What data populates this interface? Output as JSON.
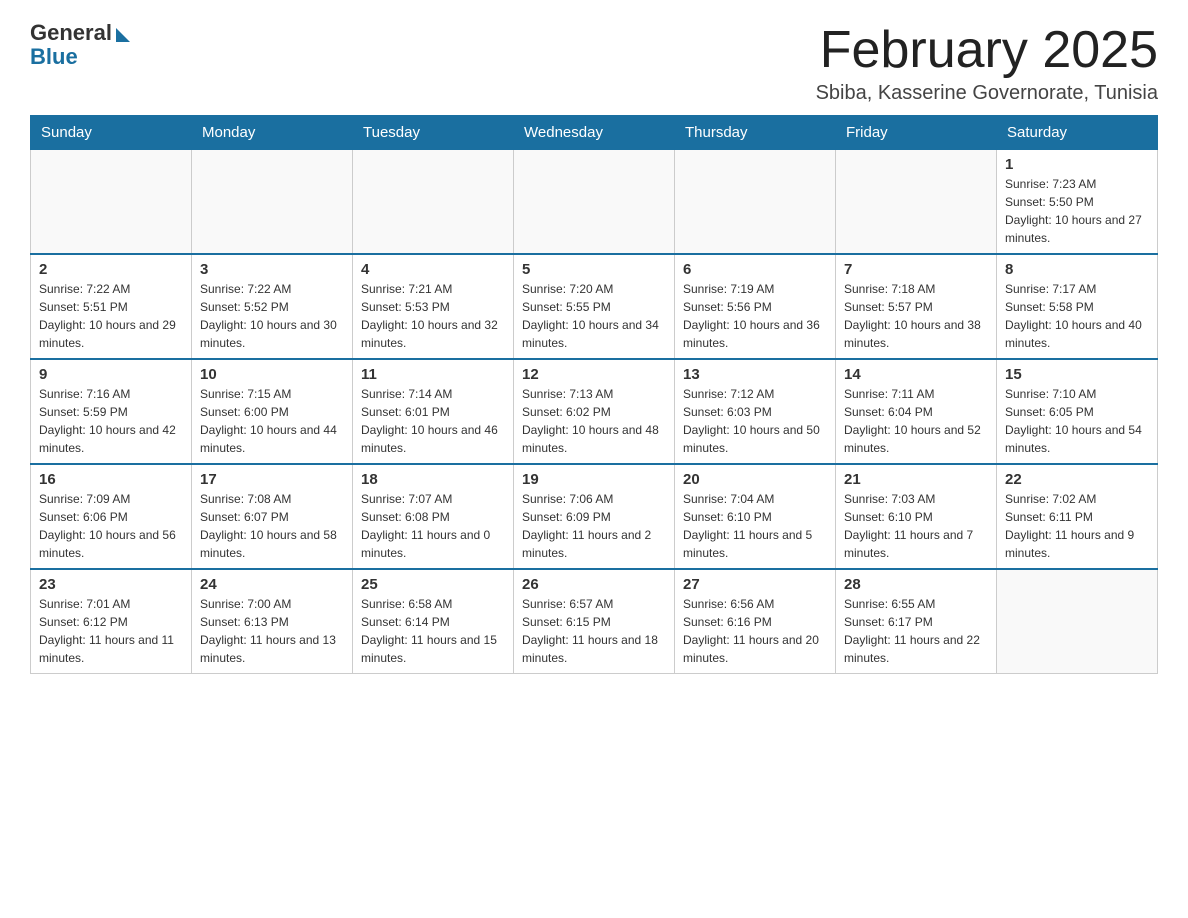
{
  "header": {
    "logo_general": "General",
    "logo_blue": "Blue",
    "month_title": "February 2025",
    "location": "Sbiba, Kasserine Governorate, Tunisia"
  },
  "weekdays": [
    "Sunday",
    "Monday",
    "Tuesday",
    "Wednesday",
    "Thursday",
    "Friday",
    "Saturday"
  ],
  "weeks": [
    [
      {
        "day": "",
        "info": ""
      },
      {
        "day": "",
        "info": ""
      },
      {
        "day": "",
        "info": ""
      },
      {
        "day": "",
        "info": ""
      },
      {
        "day": "",
        "info": ""
      },
      {
        "day": "",
        "info": ""
      },
      {
        "day": "1",
        "info": "Sunrise: 7:23 AM\nSunset: 5:50 PM\nDaylight: 10 hours and 27 minutes."
      }
    ],
    [
      {
        "day": "2",
        "info": "Sunrise: 7:22 AM\nSunset: 5:51 PM\nDaylight: 10 hours and 29 minutes."
      },
      {
        "day": "3",
        "info": "Sunrise: 7:22 AM\nSunset: 5:52 PM\nDaylight: 10 hours and 30 minutes."
      },
      {
        "day": "4",
        "info": "Sunrise: 7:21 AM\nSunset: 5:53 PM\nDaylight: 10 hours and 32 minutes."
      },
      {
        "day": "5",
        "info": "Sunrise: 7:20 AM\nSunset: 5:55 PM\nDaylight: 10 hours and 34 minutes."
      },
      {
        "day": "6",
        "info": "Sunrise: 7:19 AM\nSunset: 5:56 PM\nDaylight: 10 hours and 36 minutes."
      },
      {
        "day": "7",
        "info": "Sunrise: 7:18 AM\nSunset: 5:57 PM\nDaylight: 10 hours and 38 minutes."
      },
      {
        "day": "8",
        "info": "Sunrise: 7:17 AM\nSunset: 5:58 PM\nDaylight: 10 hours and 40 minutes."
      }
    ],
    [
      {
        "day": "9",
        "info": "Sunrise: 7:16 AM\nSunset: 5:59 PM\nDaylight: 10 hours and 42 minutes."
      },
      {
        "day": "10",
        "info": "Sunrise: 7:15 AM\nSunset: 6:00 PM\nDaylight: 10 hours and 44 minutes."
      },
      {
        "day": "11",
        "info": "Sunrise: 7:14 AM\nSunset: 6:01 PM\nDaylight: 10 hours and 46 minutes."
      },
      {
        "day": "12",
        "info": "Sunrise: 7:13 AM\nSunset: 6:02 PM\nDaylight: 10 hours and 48 minutes."
      },
      {
        "day": "13",
        "info": "Sunrise: 7:12 AM\nSunset: 6:03 PM\nDaylight: 10 hours and 50 minutes."
      },
      {
        "day": "14",
        "info": "Sunrise: 7:11 AM\nSunset: 6:04 PM\nDaylight: 10 hours and 52 minutes."
      },
      {
        "day": "15",
        "info": "Sunrise: 7:10 AM\nSunset: 6:05 PM\nDaylight: 10 hours and 54 minutes."
      }
    ],
    [
      {
        "day": "16",
        "info": "Sunrise: 7:09 AM\nSunset: 6:06 PM\nDaylight: 10 hours and 56 minutes."
      },
      {
        "day": "17",
        "info": "Sunrise: 7:08 AM\nSunset: 6:07 PM\nDaylight: 10 hours and 58 minutes."
      },
      {
        "day": "18",
        "info": "Sunrise: 7:07 AM\nSunset: 6:08 PM\nDaylight: 11 hours and 0 minutes."
      },
      {
        "day": "19",
        "info": "Sunrise: 7:06 AM\nSunset: 6:09 PM\nDaylight: 11 hours and 2 minutes."
      },
      {
        "day": "20",
        "info": "Sunrise: 7:04 AM\nSunset: 6:10 PM\nDaylight: 11 hours and 5 minutes."
      },
      {
        "day": "21",
        "info": "Sunrise: 7:03 AM\nSunset: 6:10 PM\nDaylight: 11 hours and 7 minutes."
      },
      {
        "day": "22",
        "info": "Sunrise: 7:02 AM\nSunset: 6:11 PM\nDaylight: 11 hours and 9 minutes."
      }
    ],
    [
      {
        "day": "23",
        "info": "Sunrise: 7:01 AM\nSunset: 6:12 PM\nDaylight: 11 hours and 11 minutes."
      },
      {
        "day": "24",
        "info": "Sunrise: 7:00 AM\nSunset: 6:13 PM\nDaylight: 11 hours and 13 minutes."
      },
      {
        "day": "25",
        "info": "Sunrise: 6:58 AM\nSunset: 6:14 PM\nDaylight: 11 hours and 15 minutes."
      },
      {
        "day": "26",
        "info": "Sunrise: 6:57 AM\nSunset: 6:15 PM\nDaylight: 11 hours and 18 minutes."
      },
      {
        "day": "27",
        "info": "Sunrise: 6:56 AM\nSunset: 6:16 PM\nDaylight: 11 hours and 20 minutes."
      },
      {
        "day": "28",
        "info": "Sunrise: 6:55 AM\nSunset: 6:17 PM\nDaylight: 11 hours and 22 minutes."
      },
      {
        "day": "",
        "info": ""
      }
    ]
  ]
}
